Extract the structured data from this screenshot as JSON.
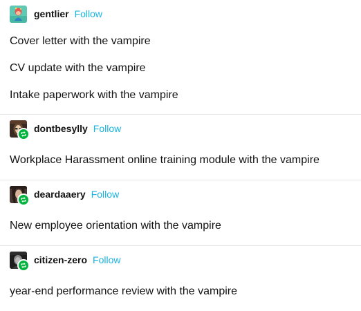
{
  "follow_label": "Follow",
  "posts": [
    {
      "username": "gentlier",
      "lines": [
        "Cover letter with the vampire",
        "CV update with the vampire",
        "Intake paperwork with the vampire"
      ]
    },
    {
      "username": "dontbesylly",
      "reblogged": true,
      "lines": [
        "Workplace Harassment online training module with the vampire"
      ]
    },
    {
      "username": "deardaaery",
      "reblogged": true,
      "lines": [
        "New employee orientation with the vampire"
      ]
    },
    {
      "username": "citizen-zero",
      "reblogged": true,
      "lines": [
        "year-end performance review with the vampire"
      ]
    }
  ],
  "colors": {
    "follow": "#18b4e0",
    "reblog_badge": "#00b33c",
    "divider": "#e6e6e6"
  },
  "icons": [
    "avatar-gentlier",
    "avatar-dontbesylly",
    "avatar-deardaaery",
    "avatar-citizen-zero",
    "reblog-icon"
  ]
}
